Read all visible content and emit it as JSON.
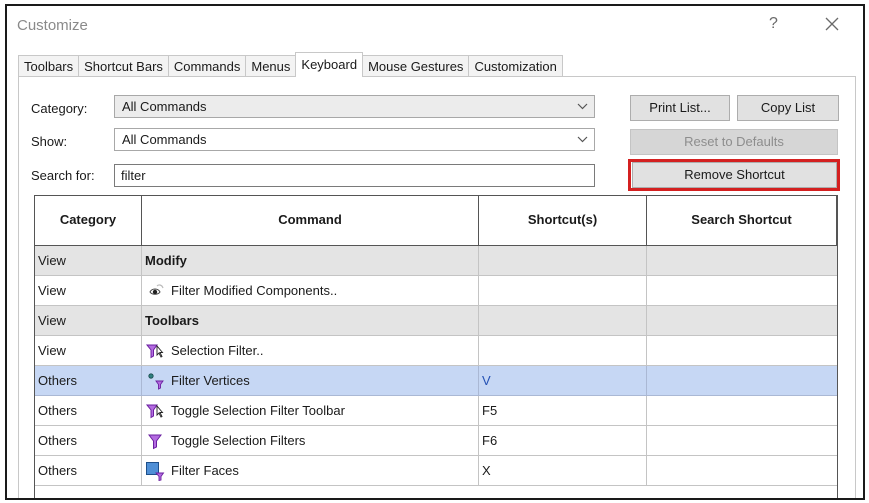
{
  "window": {
    "title": "Customize",
    "help_label": "?"
  },
  "tabs": [
    {
      "label": "Toolbars",
      "active": false
    },
    {
      "label": "Shortcut Bars",
      "active": false
    },
    {
      "label": "Commands",
      "active": false
    },
    {
      "label": "Menus",
      "active": false
    },
    {
      "label": "Keyboard",
      "active": true
    },
    {
      "label": "Mouse Gestures",
      "active": false
    },
    {
      "label": "Customization",
      "active": false
    }
  ],
  "filters": {
    "category_label": "Category:",
    "category_value": "All Commands",
    "show_label": "Show:",
    "show_value": "All Commands",
    "search_label": "Search for:",
    "search_value": "filter"
  },
  "buttons": {
    "print_list": "Print List...",
    "copy_list": "Copy List",
    "reset_defaults": "Reset to Defaults",
    "remove_shortcut": "Remove Shortcut"
  },
  "table": {
    "headers": [
      "Category",
      "Command",
      "Shortcut(s)",
      "Search Shortcut"
    ],
    "rows": [
      {
        "category": "View",
        "command": "Modify",
        "shortcut": "",
        "search": "",
        "type": "group",
        "icon": ""
      },
      {
        "category": "View",
        "command": "Filter Modified Components..",
        "shortcut": "",
        "search": "",
        "type": "item",
        "icon": "eye-icon"
      },
      {
        "category": "View",
        "command": "Toolbars",
        "shortcut": "",
        "search": "",
        "type": "group",
        "icon": ""
      },
      {
        "category": "View",
        "command": "Selection Filter..",
        "shortcut": "",
        "search": "",
        "type": "item",
        "icon": "filter-cursor-icon"
      },
      {
        "category": "Others",
        "command": "Filter Vertices",
        "shortcut": "V",
        "search": "",
        "type": "selected",
        "icon": "filter-vertices-icon"
      },
      {
        "category": "Others",
        "command": "Toggle Selection Filter Toolbar",
        "shortcut": "F5",
        "search": "",
        "type": "item",
        "icon": "filter-cursor-icon"
      },
      {
        "category": "Others",
        "command": "Toggle Selection Filters",
        "shortcut": "F6",
        "search": "",
        "type": "item",
        "icon": "funnel-icon"
      },
      {
        "category": "Others",
        "command": "Filter Faces",
        "shortcut": "X",
        "search": "",
        "type": "item",
        "icon": "filter-faces-icon"
      }
    ]
  },
  "colors": {
    "selection": "#c6d7f4",
    "group_row": "#e4e4e4",
    "highlight_border": "#d42020",
    "filter_icon": "#8b2fc9"
  }
}
